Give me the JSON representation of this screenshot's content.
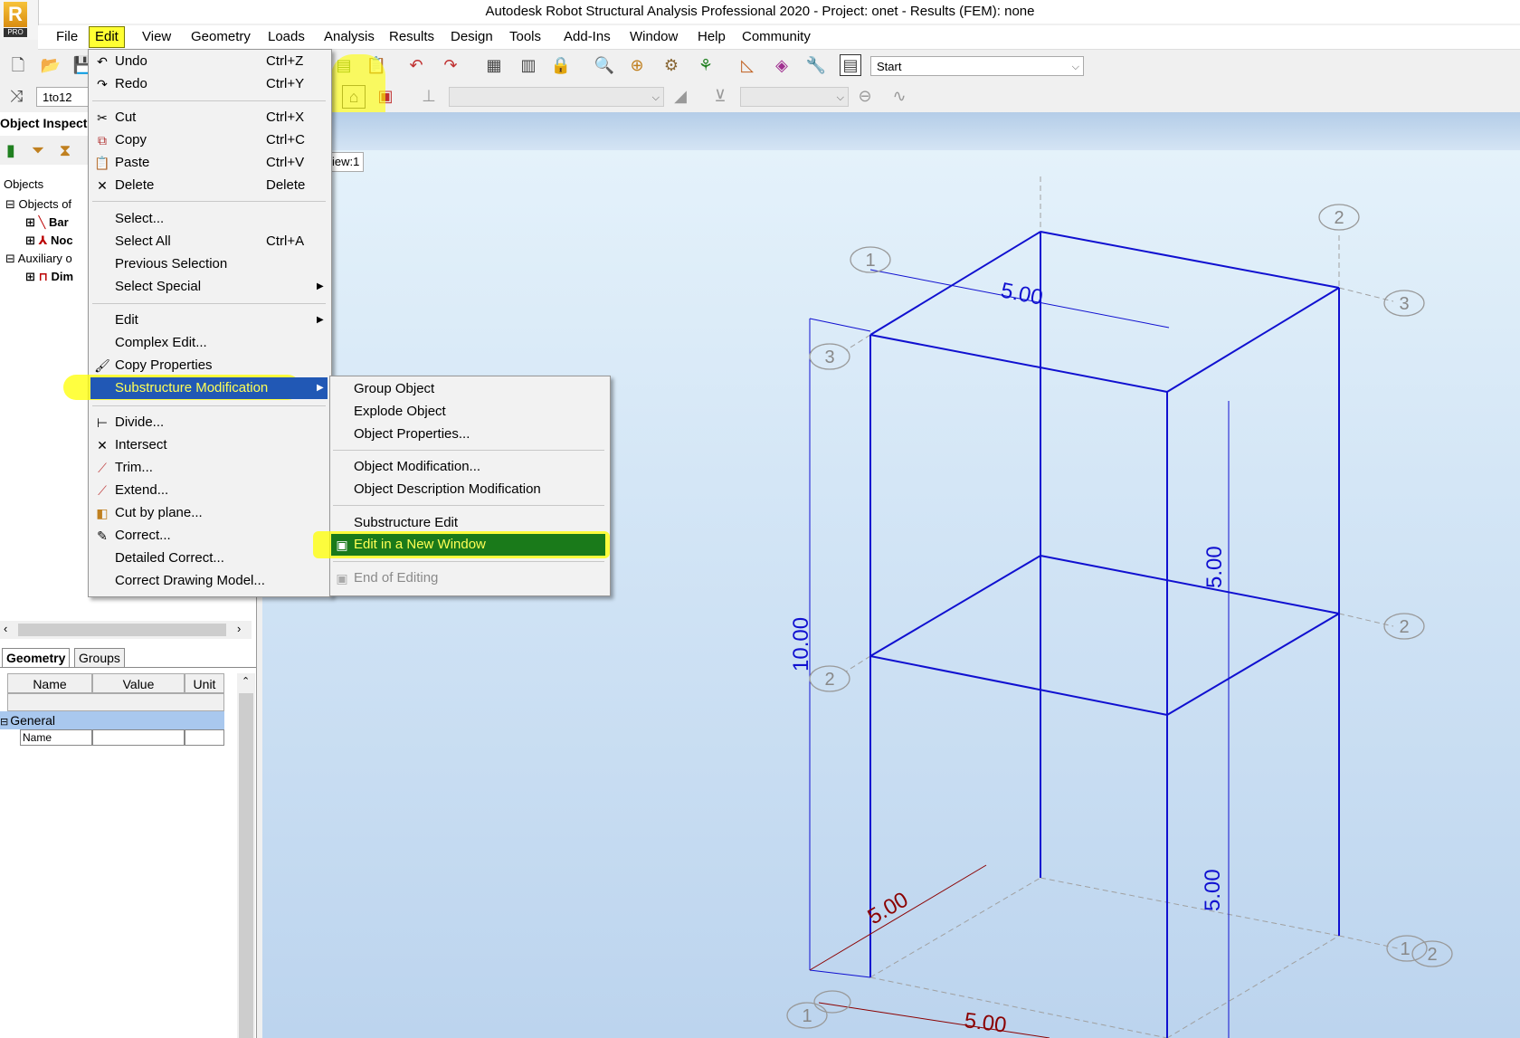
{
  "window": {
    "title": "Autodesk Robot Structural Analysis Professional 2020 - Project: onet - Results (FEM): none"
  },
  "app_logo": {
    "letter": "R",
    "badge": "PRO"
  },
  "menubar": [
    "File",
    "Edit",
    "View",
    "Geometry",
    "Loads",
    "Analysis",
    "Results",
    "Design",
    "Tools",
    "Add-Ins",
    "Window",
    "Help",
    "Community"
  ],
  "toolbar": {
    "layout_combo": "Start",
    "selection_field": "1to12"
  },
  "left_panel": {
    "title": "Object Inspect",
    "objects_label": "Objects",
    "tree": [
      "Objects of",
      "Bar",
      "Noc",
      "Auxiliary o",
      "Dim"
    ],
    "tabs": [
      "Geometry",
      "Groups"
    ],
    "columns": [
      "Name",
      "Value",
      "Unit"
    ],
    "group": "General",
    "row_name": "Name"
  },
  "view_tab": "iew:1",
  "edit_menu": [
    {
      "label": "Undo",
      "shortcut": "Ctrl+Z",
      "icon": "undo-icon"
    },
    {
      "label": "Redo",
      "shortcut": "Ctrl+Y",
      "icon": "redo-icon"
    },
    {
      "label": "Cut",
      "shortcut": "Ctrl+X",
      "icon": "cut-icon"
    },
    {
      "label": "Copy",
      "shortcut": "Ctrl+C",
      "icon": "copy-icon"
    },
    {
      "label": "Paste",
      "shortcut": "Ctrl+V",
      "icon": "paste-icon"
    },
    {
      "label": "Delete",
      "shortcut": "Delete",
      "icon": "delete-icon"
    },
    {
      "label": "Select...",
      "shortcut": ""
    },
    {
      "label": "Select All",
      "shortcut": "Ctrl+A"
    },
    {
      "label": "Previous Selection",
      "shortcut": ""
    },
    {
      "label": "Select Special",
      "shortcut": ""
    },
    {
      "label": "Edit",
      "shortcut": ""
    },
    {
      "label": "Complex Edit...",
      "shortcut": ""
    },
    {
      "label": "Copy Properties",
      "shortcut": "",
      "icon": "brush-icon"
    },
    {
      "label": "Substructure Modification",
      "shortcut": ""
    },
    {
      "label": "Divide...",
      "shortcut": "",
      "icon": "divide-icon"
    },
    {
      "label": "Intersect",
      "shortcut": "",
      "icon": "intersect-icon"
    },
    {
      "label": "Trim...",
      "shortcut": "",
      "icon": "trim-icon"
    },
    {
      "label": "Extend...",
      "shortcut": "",
      "icon": "extend-icon"
    },
    {
      "label": "Cut by plane...",
      "shortcut": "",
      "icon": "cut-plane-icon"
    },
    {
      "label": "Correct...",
      "shortcut": "",
      "icon": "correct-icon"
    },
    {
      "label": "Detailed Correct...",
      "shortcut": ""
    },
    {
      "label": "Correct Drawing Model...",
      "shortcut": ""
    }
  ],
  "submenu": [
    {
      "label": "Group Object"
    },
    {
      "label": "Explode Object"
    },
    {
      "label": "Object Properties..."
    },
    {
      "label": "Object Modification..."
    },
    {
      "label": "Object Description Modification"
    },
    {
      "label": "Substructure Edit"
    },
    {
      "label": "Edit in a New Window"
    },
    {
      "label": "End of Editing"
    }
  ],
  "model": {
    "dimensions": [
      "5.00",
      "5.00",
      "10.00",
      "5.00",
      "5.00",
      "5.00"
    ],
    "grid_labels": [
      "1",
      "2",
      "3",
      "3",
      "2",
      "2",
      "1",
      "2",
      "1"
    ]
  },
  "colors": {
    "highlight_green": "#1a7a1a",
    "highlight_yellow": "#ffff33",
    "model_blue": "#1010d0",
    "dim_darkred": "#8b0000"
  }
}
